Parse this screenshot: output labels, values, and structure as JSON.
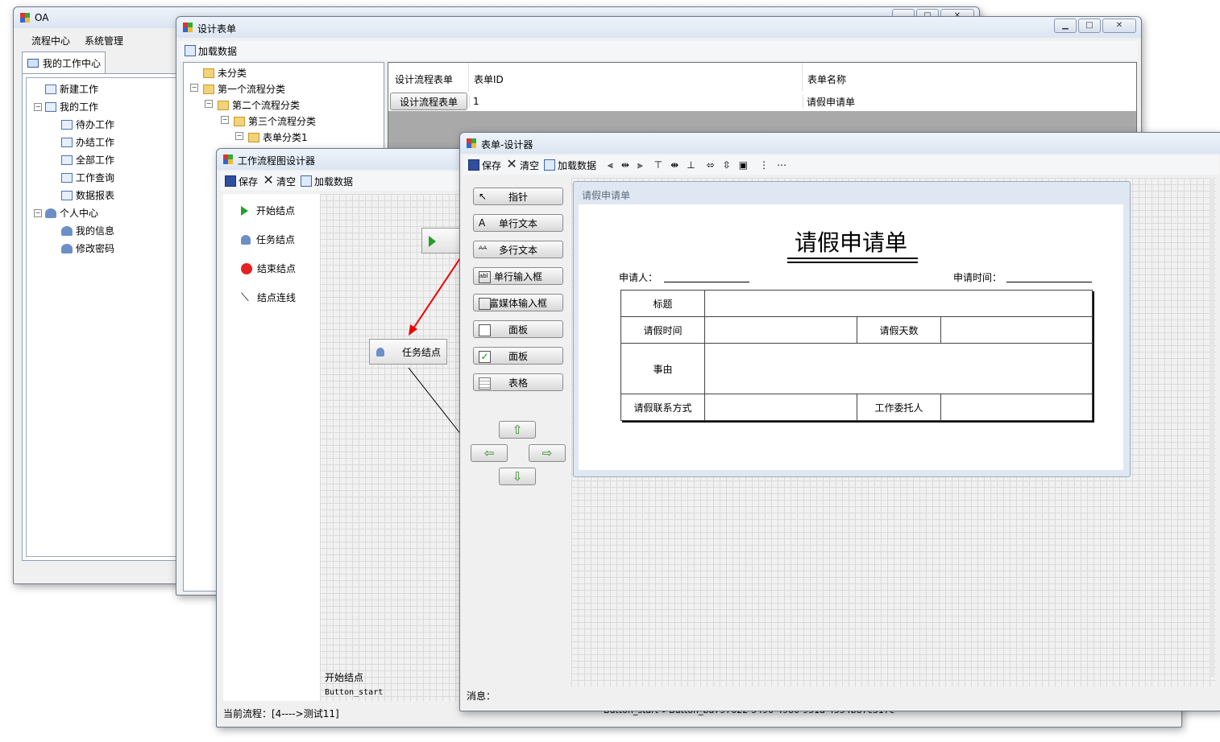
{
  "oa_window": {
    "title": "OA",
    "menu": [
      "流程中心",
      "系统管理"
    ],
    "tab": "我的工作中心",
    "tree": [
      {
        "label": "新建工作",
        "icon": "new-doc-icon"
      },
      {
        "label": "我的工作",
        "icon": "window-icon"
      },
      {
        "label": "待办工作",
        "icon": "edit-doc-icon"
      },
      {
        "label": "办结工作",
        "icon": "done-doc-icon"
      },
      {
        "label": "全部工作",
        "icon": "all-docs-icon"
      },
      {
        "label": "工作查询",
        "icon": "search-doc-icon"
      },
      {
        "label": "数据报表",
        "icon": "grid-icon"
      },
      {
        "label": "个人中心",
        "icon": "user-icon"
      },
      {
        "label": "我的信息",
        "icon": "user-edit-icon"
      },
      {
        "label": "修改密码",
        "icon": "user-key-icon"
      }
    ]
  },
  "form_design_window": {
    "title": "设计表单",
    "toolbar_load": "加载数据",
    "tree": [
      {
        "label": "未分类",
        "icon": "folder-icon"
      },
      {
        "label": "第一个流程分类",
        "icon": "folder-icon"
      },
      {
        "label": "第二个流程分类",
        "icon": "folder-icon"
      },
      {
        "label": "第三个流程分类",
        "icon": "folder-icon"
      },
      {
        "label": "表单分类1",
        "icon": "folder-icon"
      }
    ],
    "grid": {
      "headers": [
        "设计流程表单",
        "表单ID",
        "表单名称"
      ],
      "rows": [
        [
          "设计流程表单",
          "1",
          "请假申请单"
        ]
      ]
    }
  },
  "workflow_window": {
    "title": "工作流程图设计器",
    "toolbar": {
      "save": "保存",
      "clear": "清空",
      "load": "加载数据"
    },
    "palette": [
      {
        "label": "开始结点",
        "icon": "play-icon"
      },
      {
        "label": "任务结点",
        "icon": "user-icon"
      },
      {
        "label": "结束结点",
        "icon": "stop-icon"
      },
      {
        "label": "结点连线",
        "icon": "line-icon"
      }
    ],
    "task_node_label": "任务结点",
    "canvas_caption": "开始结点",
    "canvas_sub_caption": "Button_start",
    "status": "当前流程：[4---->测试11]",
    "status_right": "Button_start->Button_ba797622-5490-4980-951a-4554b87c317c"
  },
  "form_designer_window": {
    "title": "表单-设计器",
    "toolbar": {
      "save": "保存",
      "clear": "清空",
      "load": "加载数据"
    },
    "tools": [
      {
        "label": "指针",
        "icon": "pointer-icon"
      },
      {
        "label": "单行文本",
        "icon": "text-a-icon"
      },
      {
        "label": "多行文本",
        "icon": "text-aa-icon"
      },
      {
        "label": "单行输入框",
        "icon": "textbox-icon"
      },
      {
        "label": "富媒体输入框",
        "icon": "richtext-icon"
      },
      {
        "label": "面板",
        "icon": "checkbox-empty-icon"
      },
      {
        "label": "面板",
        "icon": "checkbox-checked-icon"
      },
      {
        "label": "表格",
        "icon": "table-icon"
      }
    ],
    "arrows": {
      "up": "⇧",
      "left": "⇦",
      "right": "⇨",
      "down": "⇩"
    },
    "panel_title": "请假申请单",
    "form": {
      "heading": "请假申请单",
      "applicant_label": "申请人：",
      "time_label": "申请时间：",
      "rows": {
        "title": "标题",
        "leave_time": "请假时间",
        "leave_days": "请假天数",
        "reason": "事由",
        "contact": "请假联系方式",
        "delegate": "工作委托人"
      }
    },
    "status": "消息："
  }
}
